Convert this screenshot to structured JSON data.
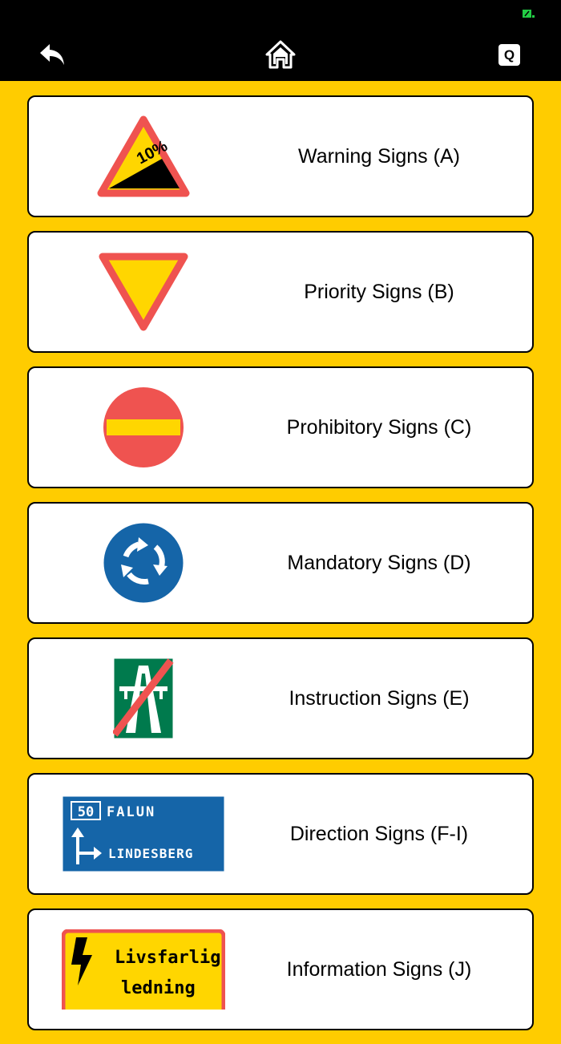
{
  "status_bar": {
    "battery_color": "#22cc44"
  },
  "toolbar": {
    "back_icon": "back-arrow-icon",
    "home_icon": "home-icon",
    "quiz_label": "Q"
  },
  "colors": {
    "background": "#FFCC00",
    "topbar": "#000000",
    "sign_red": "#EF5350",
    "sign_yellow": "#FFD600",
    "sign_blue": "#1565A8",
    "sign_green": "#007A4D"
  },
  "categories": [
    {
      "label": "Warning Signs (A)",
      "sign_text": "10%",
      "icon": "steep-hill-warning-sign"
    },
    {
      "label": "Priority Signs (B)",
      "icon": "give-way-sign"
    },
    {
      "label": "Prohibitory Signs (C)",
      "icon": "no-entry-sign"
    },
    {
      "label": "Mandatory Signs (D)",
      "icon": "roundabout-sign"
    },
    {
      "label": "Instruction Signs (E)",
      "icon": "end-of-motorway-sign"
    },
    {
      "label": "Direction Signs (F-I)",
      "icon": "direction-sign",
      "sign_number": "50",
      "sign_place_1": "FALUN",
      "sign_place_2": "LINDESBERG"
    },
    {
      "label": "Information Signs (J)",
      "icon": "danger-high-voltage-sign",
      "sign_line_1": "Livsfarlig",
      "sign_line_2": "ledning"
    }
  ]
}
